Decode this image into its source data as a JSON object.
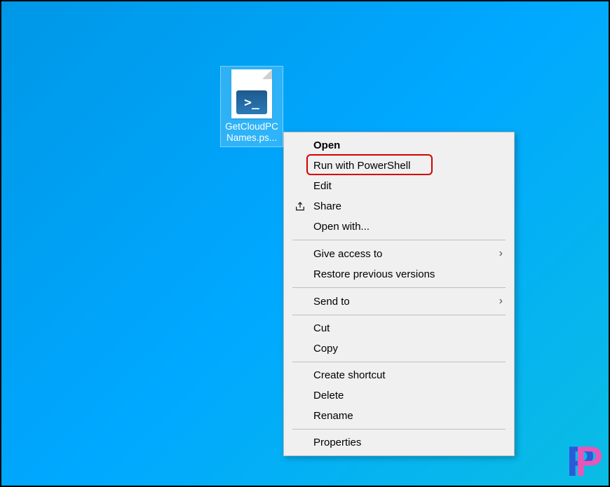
{
  "desktop": {
    "file": {
      "name": "GetCloudPCNames.ps...",
      "badge_text": ">_"
    }
  },
  "context_menu": {
    "open": "Open",
    "run_powershell": "Run with PowerShell",
    "edit": "Edit",
    "share": "Share",
    "open_with": "Open with...",
    "give_access": "Give access to",
    "restore_versions": "Restore previous versions",
    "send_to": "Send to",
    "cut": "Cut",
    "copy": "Copy",
    "create_shortcut": "Create shortcut",
    "delete": "Delete",
    "rename": "Rename",
    "properties": "Properties"
  },
  "watermark": {
    "letter": "P"
  }
}
